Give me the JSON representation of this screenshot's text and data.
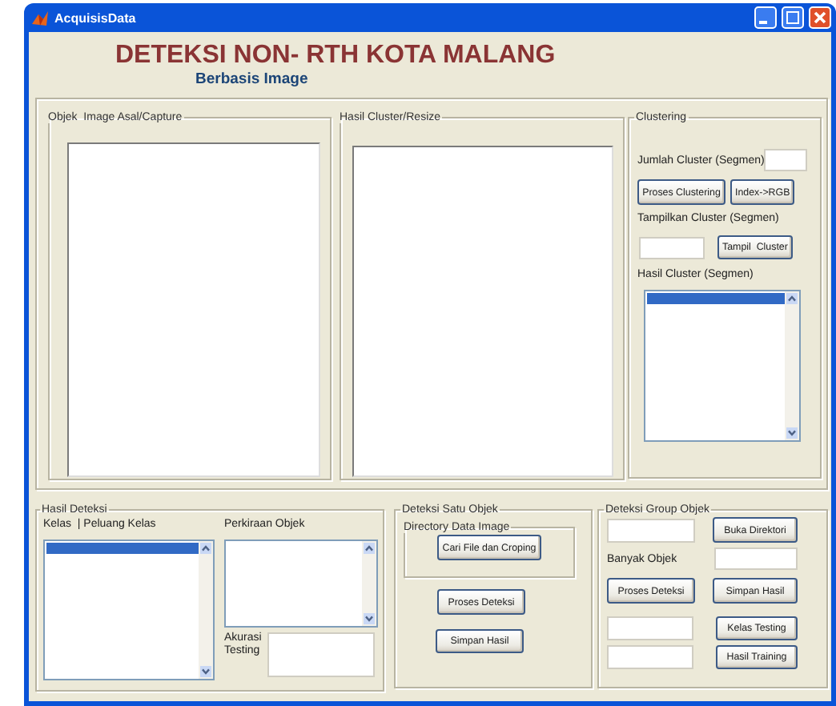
{
  "window": {
    "title": "AcquisisData"
  },
  "header": {
    "title": "DETEKSI NON- RTH KOTA MALANG",
    "subtitle": "Berbasis Image"
  },
  "image_panels": [
    {
      "title": "Objek  Image Asal/Capture"
    },
    {
      "title": "Hasil Cluster/Resize"
    }
  ],
  "clustering": {
    "title": "Clustering",
    "count_label": "Jumlah Cluster (Segmen)",
    "process_button": "Proses Clustering",
    "convert_button": "Index->RGB",
    "show_label": "Tampilkan Cluster (Segmen)",
    "show_button": "Tampil  Cluster",
    "result_label": "Hasil Cluster (Segmen)",
    "result_list": {
      "rows": [
        {
          "selected": true
        }
      ]
    }
  },
  "detection_result": {
    "title": "Hasil Deteksi",
    "class_label": "Kelas  | Peluang Kelas",
    "class_list": {
      "rows": [
        {
          "selected": true
        }
      ]
    },
    "estimate_label": "Perkiraan Objek",
    "accuracy_label": "Akurasi Testing"
  },
  "single_detection": {
    "title": "Deteksi Satu Objek",
    "directory_title": "Directory Data Image",
    "buttons": [
      "Cari File dan Croping",
      "Proses Deteksi",
      "Simpan Hasil"
    ]
  },
  "group_detection": {
    "title": "Deteksi Group Objek",
    "open_button": "Buka Direktori",
    "count_label": "Banyak Objek",
    "buttons": [
      "Proses Deteksi",
      "Simpan Hasil",
      "Kelas Testing",
      "Hasil Training"
    ]
  }
}
